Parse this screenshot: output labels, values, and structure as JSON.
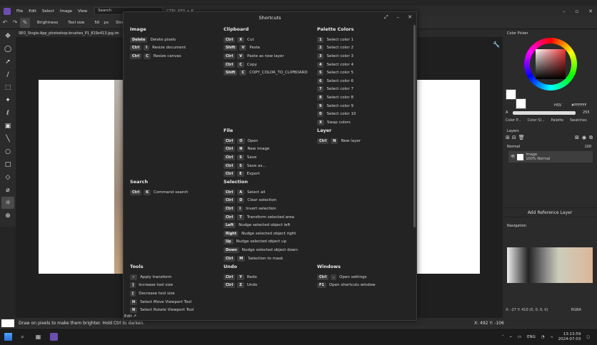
{
  "menubar": {
    "items": [
      "File",
      "Edit",
      "Select",
      "Image",
      "View"
    ],
    "search_placeholder": "Search",
    "search_hint": "CTRL KEY + K",
    "window_controls": {
      "minimize": "–",
      "maximize": "▫",
      "close": "✕"
    }
  },
  "options": {
    "tool_name": "Brightness",
    "tool_size_label": "Tool size",
    "tool_size_value": "50",
    "tool_size_unit": "px",
    "strength_label": "Streng"
  },
  "tab": {
    "filename": "SEO_Single-App_photoshop-brushes_P1_819x413.jpg.im"
  },
  "toolbar": {
    "icons": [
      "move-icon",
      "lasso-icon",
      "pointer-icon",
      "brush-icon",
      "marquee-icon",
      "magic-wand-icon",
      "lasso-select-icon",
      "bucket-icon",
      "line-icon",
      "ellipse-icon",
      "rectangle-icon",
      "eraser-icon",
      "eyedropper-icon",
      "brightness-icon",
      "zoom-icon"
    ]
  },
  "dialog": {
    "title": "Shortcuts",
    "edit_link": "Edit",
    "sections": {
      "image": {
        "title": "Image",
        "items": [
          {
            "keys": [
              "Delete"
            ],
            "label": "Delete pixels"
          },
          {
            "keys": [
              "Ctrl",
              "I"
            ],
            "label": "Resize document"
          },
          {
            "keys": [
              "Ctrl",
              "C"
            ],
            "label": "Resize canvas"
          }
        ]
      },
      "clipboard": {
        "title": "Clipboard",
        "items": [
          {
            "keys": [
              "Ctrl",
              "X"
            ],
            "label": "Cut"
          },
          {
            "keys": [
              "Shift",
              "V"
            ],
            "label": "Paste"
          },
          {
            "keys": [
              "Ctrl",
              "V"
            ],
            "label": "Paste as new layer"
          },
          {
            "keys": [
              "Ctrl",
              "C"
            ],
            "label": "Copy"
          },
          {
            "keys": [
              "Shift",
              "C"
            ],
            "label": "COPY_COLOR_TO_CLIPBOARD"
          }
        ]
      },
      "palette": {
        "title": "Palette Colors",
        "items": [
          {
            "keys": [
              "1"
            ],
            "label": "Select color 1"
          },
          {
            "keys": [
              "2"
            ],
            "label": "Select color 2"
          },
          {
            "keys": [
              "3"
            ],
            "label": "Select color 3"
          },
          {
            "keys": [
              "4"
            ],
            "label": "Select color 4"
          },
          {
            "keys": [
              "5"
            ],
            "label": "Select color 5"
          },
          {
            "keys": [
              "6"
            ],
            "label": "Select color 6"
          },
          {
            "keys": [
              "7"
            ],
            "label": "Select color 7"
          },
          {
            "keys": [
              "8"
            ],
            "label": "Select color 8"
          },
          {
            "keys": [
              "9"
            ],
            "label": "Select color 9"
          },
          {
            "keys": [
              "0"
            ],
            "label": "Select color 10"
          },
          {
            "keys": [
              "X"
            ],
            "label": "Swap colors"
          }
        ]
      },
      "file": {
        "title": "File",
        "items": [
          {
            "keys": [
              "Ctrl",
              "O"
            ],
            "label": "Open"
          },
          {
            "keys": [
              "Ctrl",
              "N"
            ],
            "label": "New image"
          },
          {
            "keys": [
              "Ctrl",
              "S"
            ],
            "label": "Save"
          },
          {
            "keys": [
              "Ctrl",
              "S"
            ],
            "label": "Save as..."
          },
          {
            "keys": [
              "Ctrl",
              "E"
            ],
            "label": "Export"
          }
        ]
      },
      "layer": {
        "title": "Layer",
        "items": [
          {
            "keys": [
              "Ctrl",
              "N"
            ],
            "label": "New layer"
          }
        ]
      },
      "search": {
        "title": "Search",
        "items": [
          {
            "keys": [
              "Ctrl",
              "K"
            ],
            "label": "Command search"
          }
        ]
      },
      "selection": {
        "title": "Selection",
        "items": [
          {
            "keys": [
              "Ctrl",
              "A"
            ],
            "label": "Select all"
          },
          {
            "keys": [
              "Ctrl",
              "D"
            ],
            "label": "Clear selection"
          },
          {
            "keys": [
              "Ctrl",
              "I"
            ],
            "label": "Invert selection"
          },
          {
            "keys": [
              "Ctrl",
              "T"
            ],
            "label": "Transform selected area"
          },
          {
            "keys": [
              "Left"
            ],
            "label": "Nudge selected object left"
          },
          {
            "keys": [
              "Right"
            ],
            "label": "Nudge selected object right"
          },
          {
            "keys": [
              "Up"
            ],
            "label": "Nudge selected object up"
          },
          {
            "keys": [
              "Down"
            ],
            "label": "Nudge selected object down"
          },
          {
            "keys": [
              "Ctrl",
              "M"
            ],
            "label": "Selection to mask"
          }
        ]
      },
      "tools": {
        "title": "Tools",
        "items": [
          {
            "keys": [
              "✓"
            ],
            "label": "Apply transform"
          },
          {
            "keys": [
              "]"
            ],
            "label": "Increase tool size"
          },
          {
            "keys": [
              "["
            ],
            "label": "Decrease tool size"
          },
          {
            "keys": [
              "H"
            ],
            "label": "Select Move Viewport Tool"
          },
          {
            "keys": [
              "N"
            ],
            "label": "Select Rotate Viewport Tool"
          }
        ]
      },
      "undo": {
        "title": "Undo",
        "items": [
          {
            "keys": [
              "Ctrl",
              "Y"
            ],
            "label": "Redo"
          },
          {
            "keys": [
              "Ctrl",
              "Z"
            ],
            "label": "Undo"
          }
        ]
      },
      "windows": {
        "title": "Windows",
        "items": [
          {
            "keys": [
              "Ctrl",
              "."
            ],
            "label": "Open settings"
          },
          {
            "keys": [
              "F1"
            ],
            "label": "Open shortcuts window"
          }
        ]
      }
    }
  },
  "colorpicker": {
    "title": "Color Picker",
    "mode": "HSV",
    "hex": "#FFFFFF",
    "alpha_label": "A",
    "alpha_value": "255",
    "tabs": [
      "Color P...",
      "Color Sl...",
      "Palette",
      "Swatches"
    ],
    "primary_color": "#ffffff",
    "secondary_color": "#ffffff"
  },
  "layers": {
    "title": "Layers",
    "blend_mode": "Normal",
    "opacity": "100",
    "layer_name": "Image",
    "layer_info": "100% Normal"
  },
  "add_reference": "Add Reference Layer",
  "navigation": {
    "title": "Navigation",
    "coords": "X: -27 Y: 410  (0, 0, 0, 0)",
    "color_mode": "RGBA"
  },
  "status": {
    "message": "Draw on pixels to make them brighter. Hold Ctrl to darken.",
    "cursor": "X: 492 Y: -106"
  },
  "taskbar": {
    "lang": "ENG",
    "time": "13:13:59",
    "date": "2024-07-03"
  }
}
